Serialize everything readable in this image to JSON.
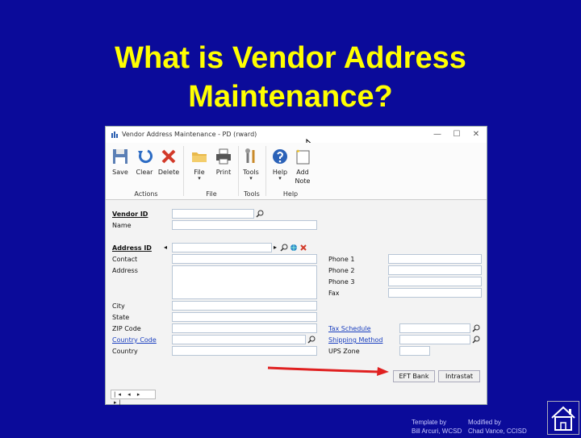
{
  "slide": {
    "title_line1": "What is Vendor Address",
    "title_line2": "Maintenance?"
  },
  "window": {
    "title": "Vendor Address Maintenance  -  PD (rward)",
    "minimize_glyph": "—",
    "restore_glyph": "☐",
    "close_glyph": "✕"
  },
  "ribbon": {
    "buttons": [
      {
        "label": "Save",
        "icon": "save-icon"
      },
      {
        "label": "Clear",
        "icon": "clear-icon"
      },
      {
        "label": "Delete",
        "icon": "delete-icon"
      },
      {
        "label": "File",
        "icon": "file-icon"
      },
      {
        "label": "Print",
        "icon": "print-icon"
      },
      {
        "label": "Tools",
        "icon": "tools-icon"
      },
      {
        "label": "Help",
        "icon": "help-icon"
      },
      {
        "label": "Add",
        "label2": "Note",
        "icon": "add-note-icon"
      }
    ],
    "groups": [
      "Actions",
      "File",
      "Tools",
      "Help"
    ],
    "drop_glyph": "▾"
  },
  "form": {
    "vendor_id_label": "Vendor ID",
    "vendor_id_value": "",
    "name_label": "Name",
    "address_id_label": "Address ID",
    "contact_label": "Contact",
    "address_label": "Address",
    "city_label": "City",
    "state_label": "State",
    "zip_label": "ZIP Code",
    "country_code_label": "Country Code",
    "country_label": "Country",
    "phone1_label": "Phone 1",
    "phone2_label": "Phone 2",
    "phone3_label": "Phone 3",
    "fax_label": "Fax",
    "tax_schedule_label": "Tax Schedule",
    "shipping_method_label": "Shipping Method",
    "ups_zone_label": "UPS Zone",
    "browse_left": "◂",
    "browse_right": "▸"
  },
  "buttons": {
    "eft_bank": "EFT Bank",
    "intrastat": "Intrastat"
  },
  "record_nav": "|◂ ◂ ▸ ▸|",
  "credits": {
    "template_by": "Template by",
    "template_author": "Bill Arcuri, WCSD",
    "modified_by": "Modified by",
    "modified_author": "Chad Vance, CCISD"
  },
  "colors": {
    "background": "#0b0b9a",
    "title": "#ffff00",
    "arrow": "#e02020",
    "link": "#1a3fbf"
  }
}
